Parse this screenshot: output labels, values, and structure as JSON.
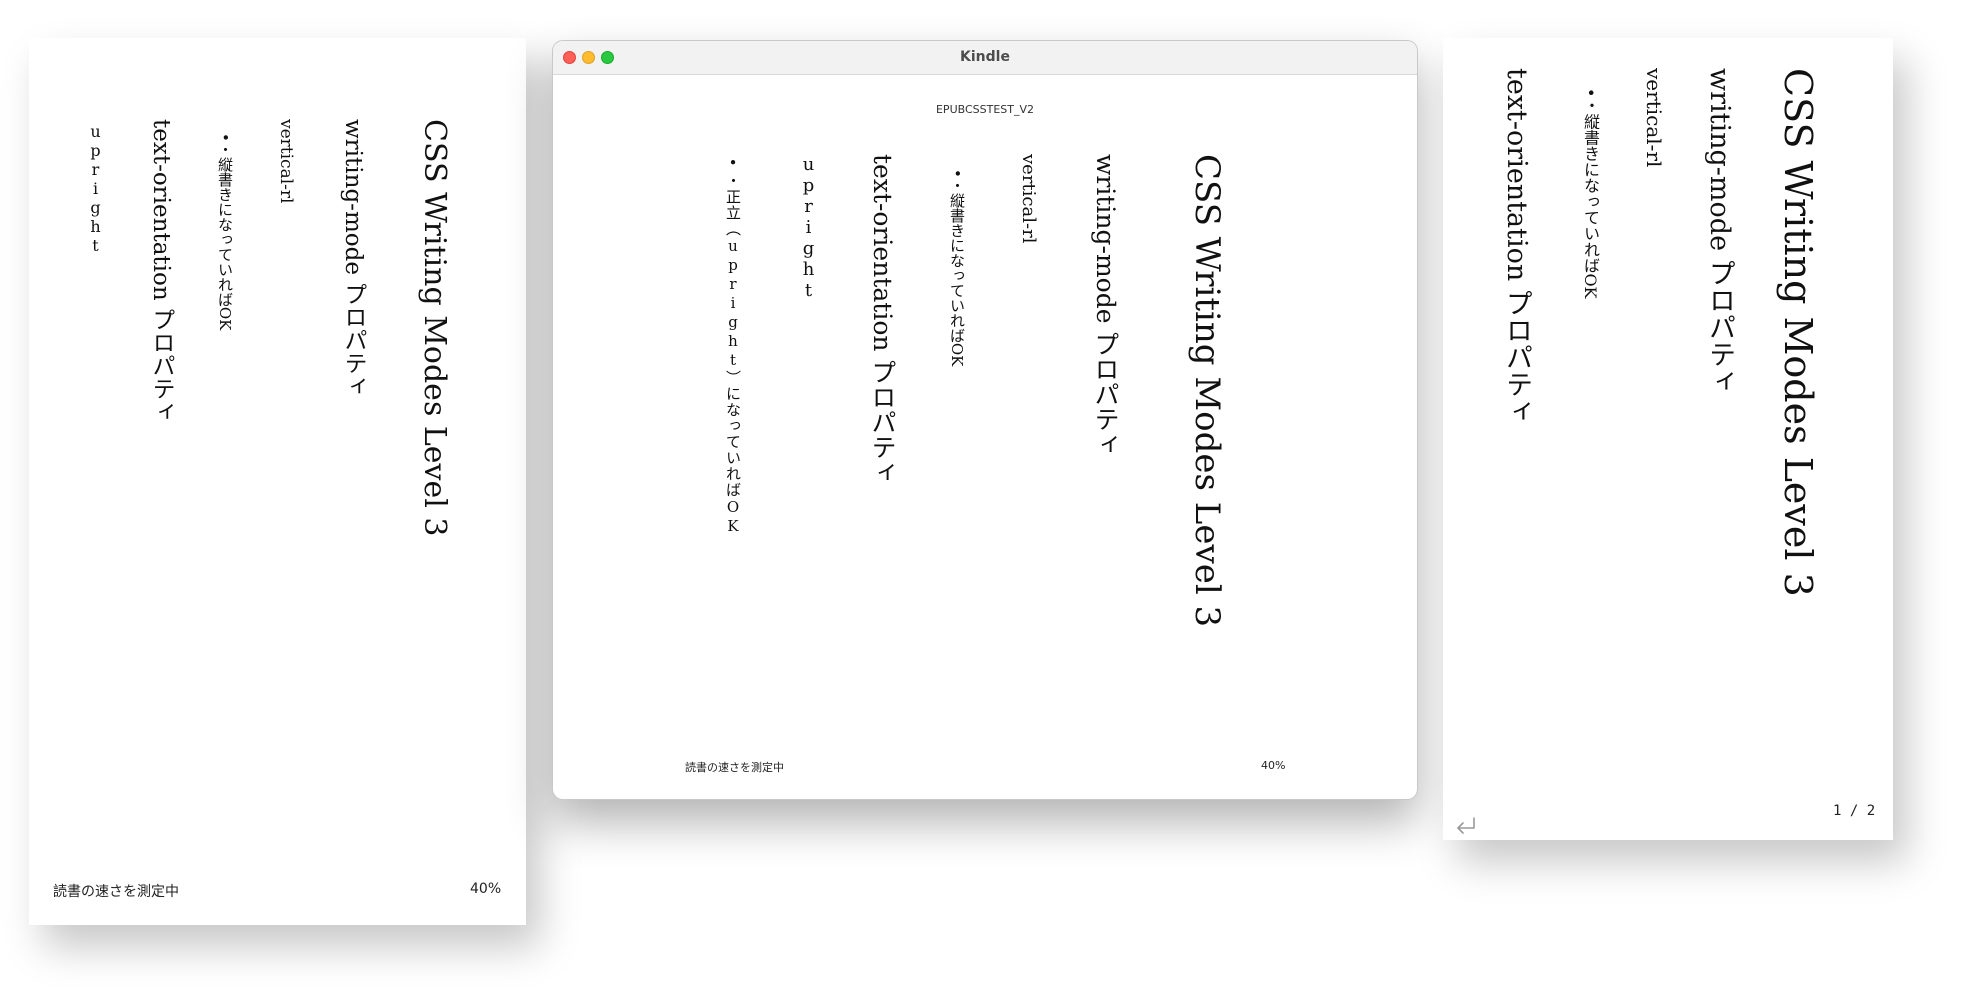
{
  "content": {
    "heading": "CSS Writing Modes Level 3",
    "writing_mode_prop": "writing-mode プロパティ",
    "vertical_rl": "vertical-rl",
    "vertical_ok": "•・縦書きになっていればOK",
    "text_orientation_prop": "text-orientation プロパティ",
    "upright": "upright",
    "upright_ok": "•・正立（upright）になっていればOK"
  },
  "left_reader": {
    "reading_speed": "読書の速さを測定中",
    "progress": "40%"
  },
  "kindle_window": {
    "app_title": "Kindle",
    "book_title": "EPUBCSSTEST_V2",
    "reading_speed": "読書の速さを測定中",
    "progress": "40%"
  },
  "right_reader": {
    "page_indicator": "1 / 2",
    "return_icon": "return-arrow-icon"
  },
  "colors": {
    "close": "#fe5f57",
    "minimize": "#febc2e",
    "zoom": "#28c840",
    "text": "#111111"
  }
}
